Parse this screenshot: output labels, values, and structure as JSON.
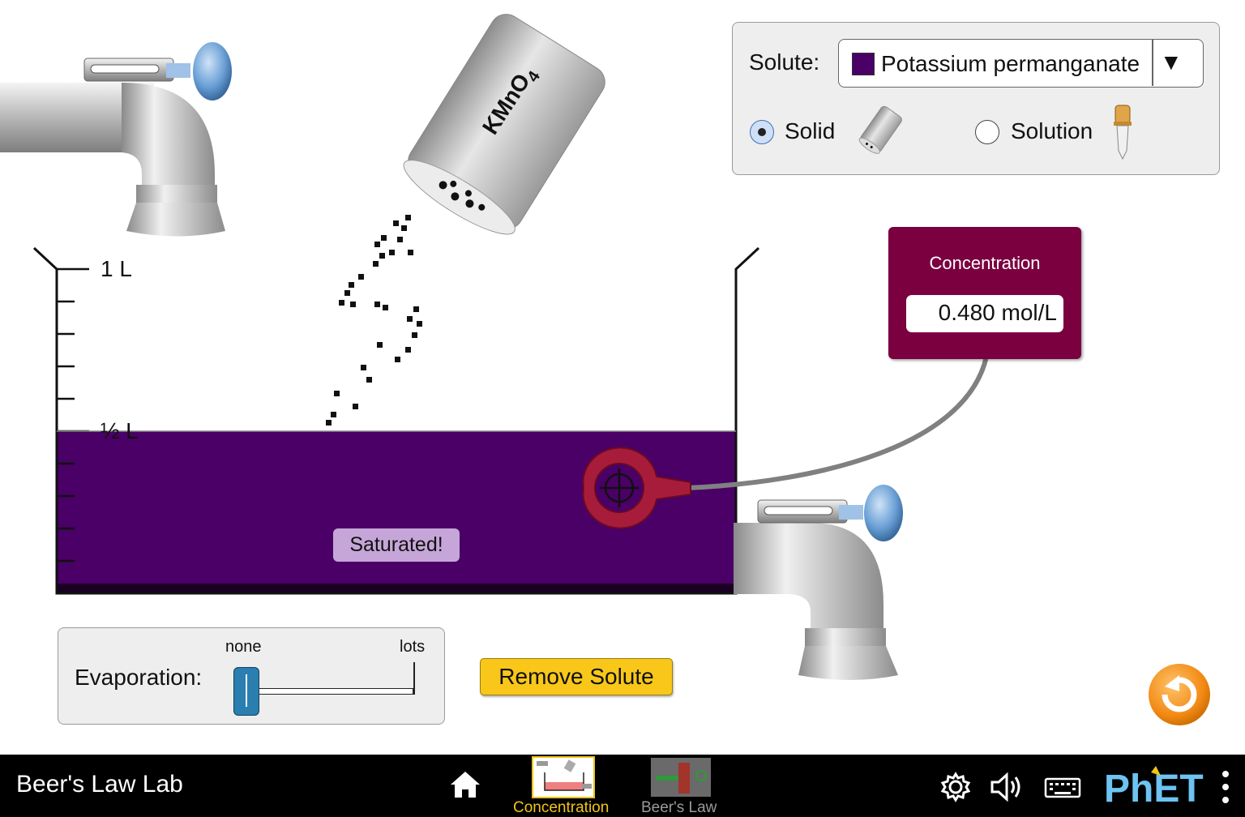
{
  "solute": {
    "label": "Solute:",
    "selected": "Potassium permanganate",
    "swatch_color": "#4a0066",
    "form_solid_label": "Solid",
    "form_solution_label": "Solution",
    "selected_form": "Solid"
  },
  "shaker": {
    "label_main": "KMnO",
    "label_sub": "4"
  },
  "beaker": {
    "label_full": "1 L",
    "label_half": "½ L",
    "solution_color": "#4a0066",
    "saturated_indicator": "Saturated!"
  },
  "concentration_meter": {
    "title": "Concentration",
    "value": "0.480 mol/L",
    "body_color": "#7a0040"
  },
  "evaporation": {
    "label": "Evaporation:",
    "min_label": "none",
    "max_label": "lots",
    "level": 0
  },
  "remove_solute_button": "Remove Solute",
  "navbar": {
    "app_title": "Beer's Law Lab",
    "screens": [
      {
        "label": "Concentration",
        "selected": true,
        "color": "#f0c419"
      },
      {
        "label": "Beer's Law",
        "selected": false,
        "color": "#9a9a9a"
      }
    ],
    "brand": "PhET"
  }
}
